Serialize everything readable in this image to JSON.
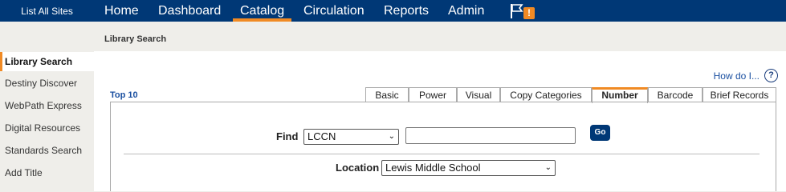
{
  "header": {
    "site_link": "List All Sites",
    "nav": [
      "Home",
      "Dashboard",
      "Catalog",
      "Circulation",
      "Reports",
      "Admin"
    ],
    "active_nav": "Catalog",
    "alert_icon": "flag-icon",
    "alert_badge": "!"
  },
  "subheader": {
    "title": "Library Search"
  },
  "sidebar": {
    "items": [
      "Library Search",
      "Destiny Discover",
      "WebPath Express",
      "Digital Resources",
      "Standards Search",
      "Add Title"
    ],
    "active": "Library Search"
  },
  "main": {
    "how_do_i": "How do I...",
    "help_icon": "?",
    "top10": "Top 10",
    "tabs": [
      "Basic",
      "Power",
      "Visual",
      "Copy Categories",
      "Number",
      "Barcode",
      "Brief Records"
    ],
    "active_tab": "Number",
    "find_label": "Find",
    "find_type": "LCCN",
    "find_value": "",
    "go_label": "Go",
    "location_label": "Location",
    "location_value": "Lewis Middle School"
  },
  "colors": {
    "topbar": "#003876",
    "accent": "#f08a24",
    "link": "#1a4fa0"
  }
}
